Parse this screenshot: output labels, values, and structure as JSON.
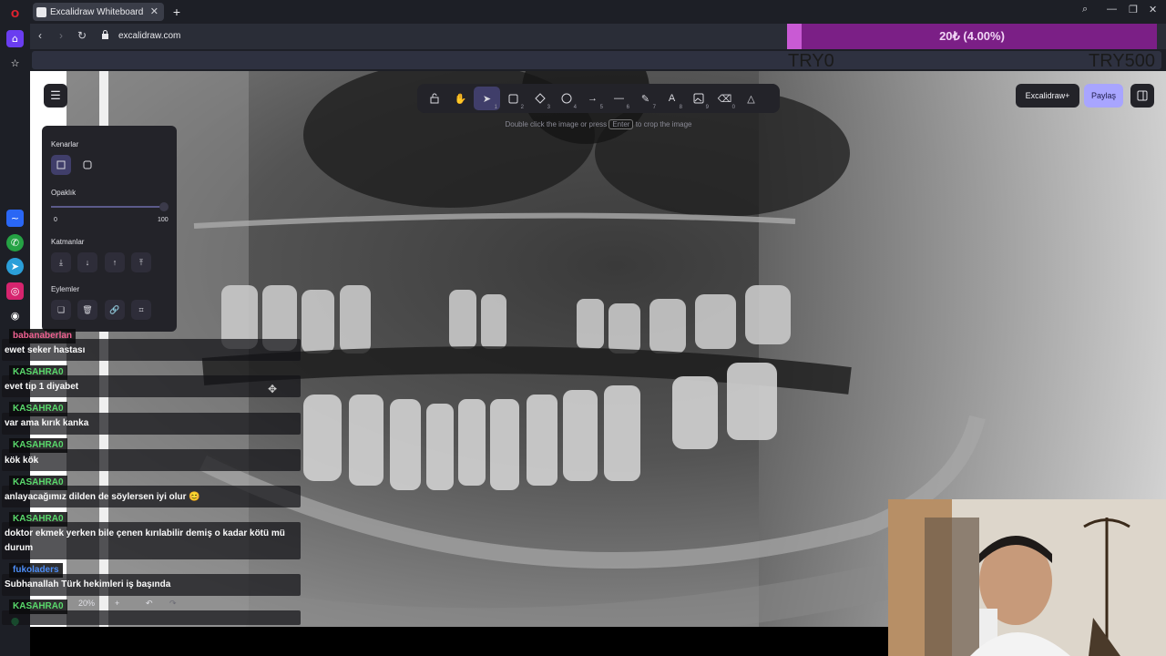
{
  "browser": {
    "tab_title": "Excalidraw Whiteboard",
    "new_tab_label": "+",
    "url": "excalidraw.com"
  },
  "donation": {
    "amount_label": "20₺ (4.00%)",
    "progress_percent": 4.0,
    "min_label": "TRY0",
    "max_label": "TRY500"
  },
  "toolbar": {
    "keys": [
      "",
      "",
      "1",
      "2",
      "3",
      "4",
      "5",
      "6",
      "7",
      "8",
      "9",
      "0",
      ""
    ],
    "hint_before": "Double click the image or press",
    "hint_key": "Enter",
    "hint_after": "to crop the image"
  },
  "top_right": {
    "excalidraw_plus": "Excalidraw+",
    "share": "Paylaş"
  },
  "props": {
    "edges_title": "Kenarlar",
    "opacity_title": "Opaklık",
    "opacity_min": "0",
    "opacity_max": "100",
    "opacity_value": 100,
    "layers_title": "Katmanlar",
    "actions_title": "Eylemler"
  },
  "chat": [
    {
      "user": "babanaberlan",
      "color": "#f06292",
      "message": "ewet seker hastası"
    },
    {
      "user": "KASAHRA0",
      "color": "#59d96b",
      "message": "evet tip 1 diyabet"
    },
    {
      "user": "KASAHRA0",
      "color": "#59d96b",
      "message": "var ama kırık kanka"
    },
    {
      "user": "KASAHRA0",
      "color": "#59d96b",
      "message": "kök kök"
    },
    {
      "user": "KASAHRA0",
      "color": "#59d96b",
      "message": "anlayacağımız dilden de söylersen iyi olur 😊"
    },
    {
      "user": "KASAHRA0",
      "color": "#59d96b",
      "message_line1": "doktor ekmek yerken bile çenen kırılabilir demiş o kadar kötü mü",
      "message_line2": "durum"
    },
    {
      "user": "fukoladers",
      "color": "#4d8df6",
      "message": "Subhanallah Türk hekimleri iş başında"
    },
    {
      "user": "KASAHRA0",
      "color": "#59d96b"
    }
  ],
  "footer": {
    "zoom": "20%",
    "zoom_in": "+",
    "undo": "↶",
    "redo": "↷"
  },
  "colors": {
    "accent": "#a8a5ff",
    "active_tool": "#403e6a",
    "panel": "#232329",
    "donation_bar": "#7b1f86"
  }
}
